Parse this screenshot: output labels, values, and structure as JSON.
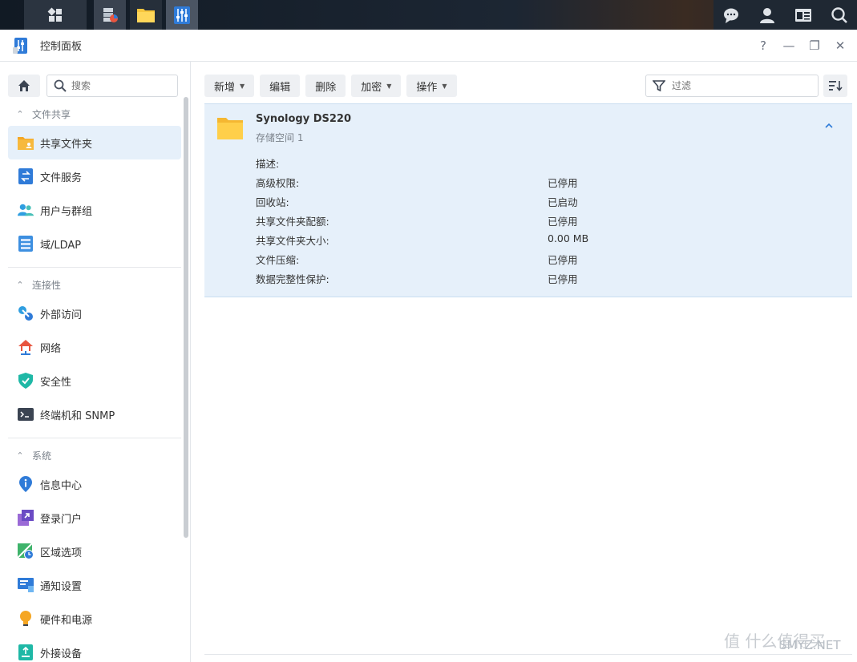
{
  "window": {
    "title": "控制面板"
  },
  "window_controls": {
    "help": "?",
    "minimize": "—",
    "restore": "❐",
    "close": "✕"
  },
  "search": {
    "placeholder": "搜索"
  },
  "sidebar": {
    "sections": [
      {
        "label": "文件共享",
        "items": [
          "共享文件夹",
          "文件服务",
          "用户与群组",
          "域/LDAP"
        ]
      },
      {
        "label": "连接性",
        "items": [
          "外部访问",
          "网络",
          "安全性",
          "终端机和 SNMP"
        ]
      },
      {
        "label": "系统",
        "items": [
          "信息中心",
          "登录门户",
          "区域选项",
          "通知设置",
          "硬件和电源",
          "外接设备"
        ]
      }
    ]
  },
  "toolbar": {
    "create": "新增",
    "edit": "编辑",
    "delete": "删除",
    "encrypt": "加密",
    "action": "操作"
  },
  "filter": {
    "placeholder": "过滤"
  },
  "shared_folder": {
    "name": "Synology DS220",
    "location": "存储空间 1",
    "properties": [
      {
        "key": "描述:",
        "value": ""
      },
      {
        "key": "高级权限:",
        "value": "已停用"
      },
      {
        "key": "回收站:",
        "value": "已启动"
      },
      {
        "key": "共享文件夹配额:",
        "value": "已停用"
      },
      {
        "key": "共享文件夹大小:",
        "value": "0.00 MB"
      },
      {
        "key": "文件压缩:",
        "value": "已停用"
      },
      {
        "key": "数据完整性保护:",
        "value": "已停用"
      }
    ]
  },
  "watermark": {
    "text": "值 什么值得买",
    "site": "SMYZ.NET"
  },
  "colors": {
    "accent": "#2f7bd8",
    "selected_bg": "#e6f0fa",
    "folder": "#f7c63d"
  }
}
